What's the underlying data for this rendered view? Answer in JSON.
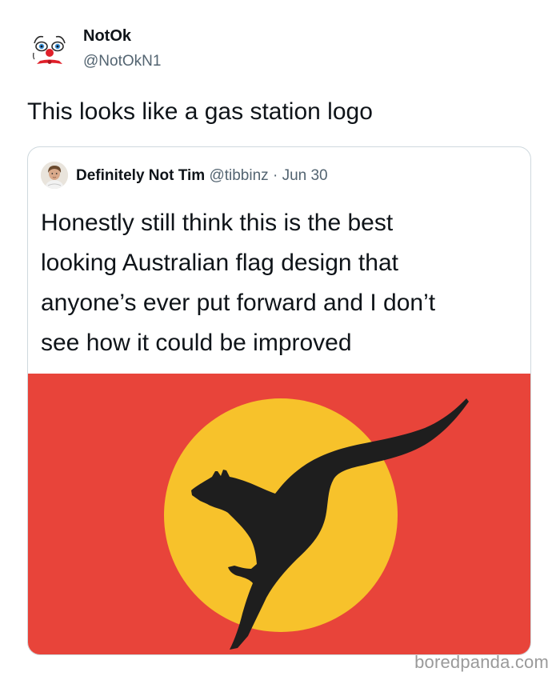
{
  "author": {
    "name": "NotOk",
    "handle": "@NotOkN1",
    "avatar_icon": "clown-face-icon"
  },
  "tweet": {
    "text": "This looks like a gas station logo"
  },
  "quoted_tweet": {
    "author_name": "Definitely Not Tim",
    "author_handle": "@tibbinz",
    "separator": "·",
    "date": "Jun 30",
    "text_lines": [
      "Honestly still think this is the best",
      "looking Australian flag design that",
      "anyone’s ever put forward and I don’t",
      "see how it could be improved"
    ],
    "avatar_icon": "profile-photo-icon",
    "image": {
      "icon": "kangaroo-flag-image",
      "colors": {
        "background": "#e8443a",
        "circle": "#f7c22b",
        "kangaroo": "#1e1e1e"
      }
    }
  },
  "watermark": "boredpanda.com"
}
